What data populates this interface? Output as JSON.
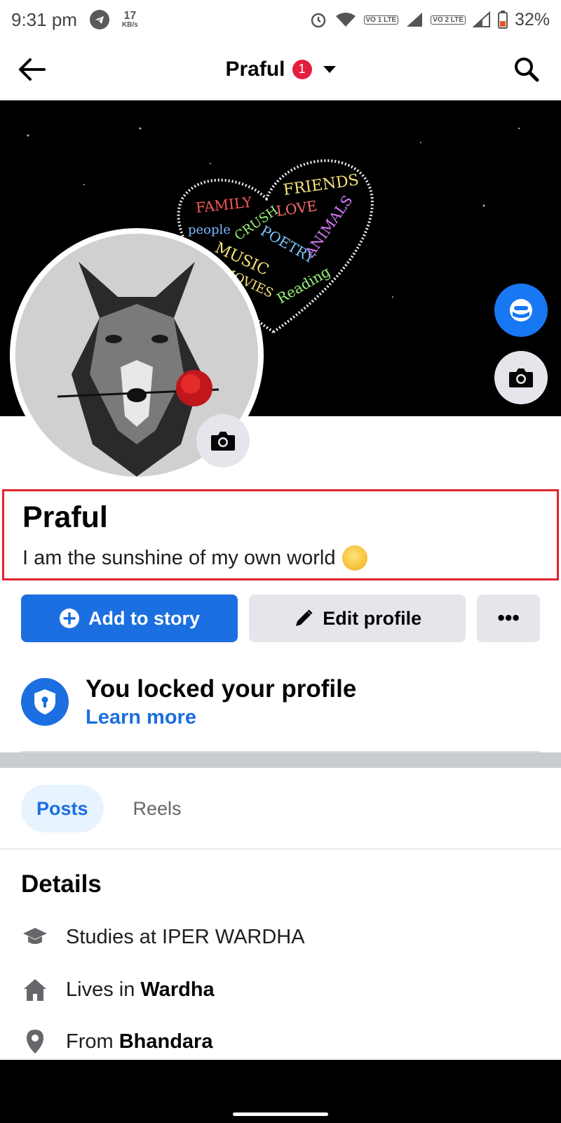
{
  "status_bar": {
    "time": "9:31 pm",
    "speed_value": "17",
    "speed_unit": "KB/s",
    "sim1_label": "VO 1 LTE",
    "sim2_label": "VO 2 LTE",
    "battery": "32%"
  },
  "app_bar": {
    "title": "Praful",
    "notification_count": "1"
  },
  "profile": {
    "name": "Praful",
    "bio": "I am the sunshine of my own world"
  },
  "actions": {
    "add_story": "Add to story",
    "edit_profile": "Edit profile",
    "more": "•••"
  },
  "locked": {
    "title": "You locked your profile",
    "link": "Learn more"
  },
  "tabs": [
    {
      "label": "Posts",
      "active": true
    },
    {
      "label": "Reels",
      "active": false
    }
  ],
  "details": {
    "title": "Details",
    "studies_text": "Studies at IPER WARDHA",
    "lives_prefix": "Lives in ",
    "lives_place": "Wardha",
    "from_prefix": "From ",
    "from_place": "Bhandara"
  },
  "cover_words": [
    "FRIENDS",
    "FAMILY",
    "LOVE",
    "people",
    "CRUSH",
    "POETRY",
    "ANIMALS",
    "MUSIC",
    "MOVIES",
    "Reading"
  ],
  "colors": {
    "accent": "#1b6fe0",
    "badge": "#e41e3f",
    "highlight_border": "#e0242f"
  },
  "icons": [
    "back-arrow-icon",
    "search-icon",
    "avatar-icon",
    "camera-icon",
    "plus-circle-icon",
    "pencil-icon",
    "shield-lock-icon",
    "graduation-cap-icon",
    "home-icon",
    "location-pin-icon"
  ]
}
